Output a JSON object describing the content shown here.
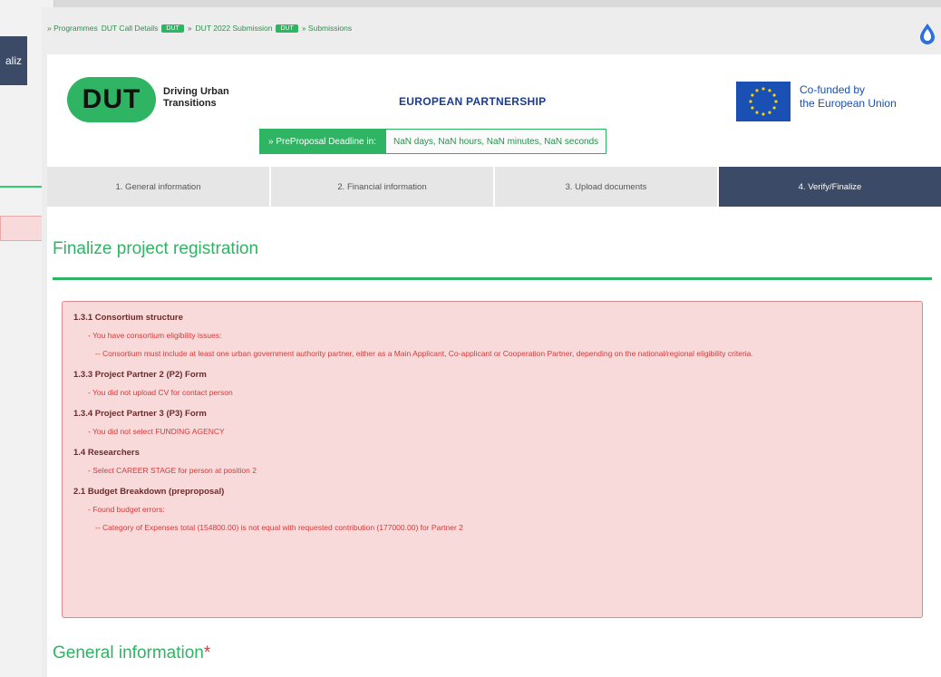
{
  "background_window": {
    "bar_label": "aliz"
  },
  "breadcrumb": {
    "items": [
      "» Programmes",
      "DUT Call Details",
      "DUT 2022 Submission",
      "» Submissions"
    ],
    "tags": [
      "DUT",
      "DUT"
    ]
  },
  "header": {
    "logo_text": "DUT",
    "logo_caption_line1": "Driving Urban",
    "logo_caption_line2": "Transitions",
    "partnership_title": "EUROPEAN PARTNERSHIP",
    "eu_text_line1": "Co-funded by",
    "eu_text_line2": "the European Union"
  },
  "deadline": {
    "label": "» PreProposal Deadline in:",
    "value": "NaN days, NaN hours, NaN minutes, NaN seconds"
  },
  "tabs": [
    {
      "label": "1. General information",
      "active": false
    },
    {
      "label": "2. Financial information",
      "active": false
    },
    {
      "label": "3. Upload documents",
      "active": false
    },
    {
      "label": "4. Verify/Finalize",
      "active": true
    }
  ],
  "page": {
    "title": "Finalize project registration",
    "general_title": "General information",
    "required_mark": "*"
  },
  "errors": [
    {
      "heading": "1.3.1 Consortium structure",
      "lines": [
        {
          "text": "- You have consortium eligibility issues:",
          "deep": false
        },
        {
          "text": "-- Consortium must include at least one urban government authority partner, either as a Main Applicant, Co-applicant or Cooperation Partner, depending on the national/regional eligibility criteria.",
          "deep": true
        }
      ]
    },
    {
      "heading": "1.3.3 Project Partner 2 (P2) Form",
      "lines": [
        {
          "text": "- You did not upload CV for contact person",
          "deep": false
        }
      ]
    },
    {
      "heading": "1.3.4 Project Partner 3 (P3) Form",
      "lines": [
        {
          "text": "- You did not select FUNDING AGENCY",
          "deep": false
        }
      ]
    },
    {
      "heading": "1.4 Researchers",
      "lines": [
        {
          "text": "- Select CAREER STAGE for person at position 2",
          "deep": false
        }
      ]
    },
    {
      "heading": "2.1 Budget Breakdown (preproposal)",
      "lines": [
        {
          "text": "- Found budget errors:",
          "deep": false
        },
        {
          "text": "-- Category of Expenses total (154800.00) is not equal with requested contribution (177000.00) for Partner 2",
          "deep": true
        }
      ]
    }
  ],
  "colors": {
    "brand_green": "#2fb463",
    "nav_dark": "#3b4a66",
    "error_red": "#d43a3a",
    "error_bg": "#f9dada",
    "eu_blue": "#1a4fb4"
  }
}
